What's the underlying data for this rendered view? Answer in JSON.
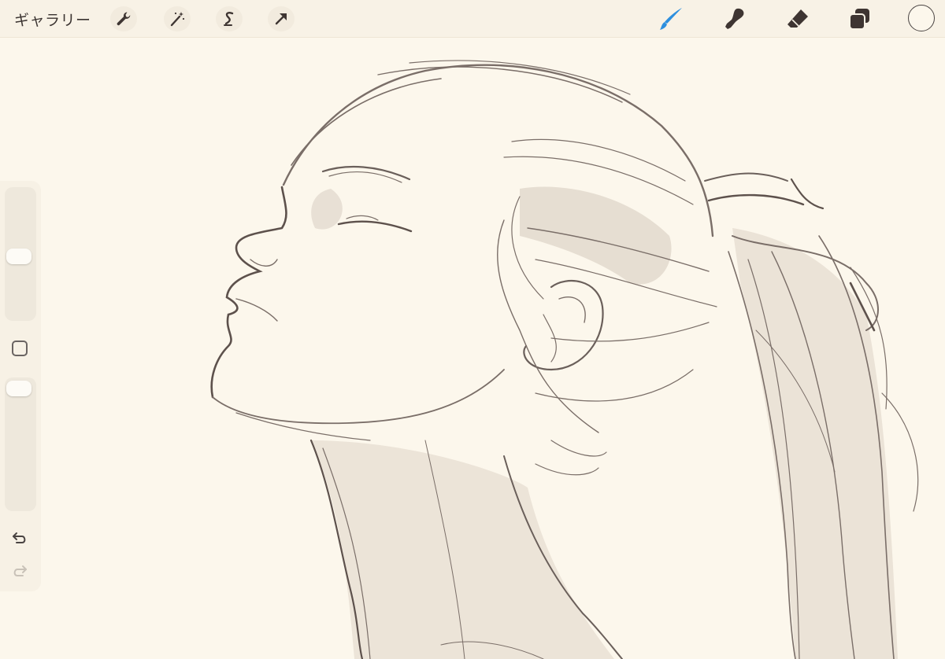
{
  "toolbar": {
    "gallery_label": "ギャラリー",
    "left_tools": [
      {
        "icon": "wrench-icon"
      },
      {
        "icon": "magic-wand-icon"
      },
      {
        "icon": "selection-icon"
      },
      {
        "icon": "transform-arrow-icon"
      }
    ],
    "right_tools": [
      {
        "icon": "brush-icon",
        "active": true
      },
      {
        "icon": "smudge-icon"
      },
      {
        "icon": "eraser-icon"
      },
      {
        "icon": "layers-icon"
      }
    ],
    "active_color": "#fcf7ec"
  },
  "sidebar": {
    "brush_size_level": 0.55,
    "opacity_level": 0.95,
    "tools": [
      {
        "icon": "modify-square-icon"
      },
      {
        "icon": "undo-icon"
      },
      {
        "icon": "redo-icon"
      }
    ]
  },
  "colors": {
    "accent": "#2e8fde",
    "toolbar_bg": "#f8f2e6",
    "canvas_bg": "#fcf7ec",
    "icon_dark": "#3e3532",
    "sketch_stroke": "#7a6e68",
    "sketch_shade": "#e9e1d6"
  }
}
